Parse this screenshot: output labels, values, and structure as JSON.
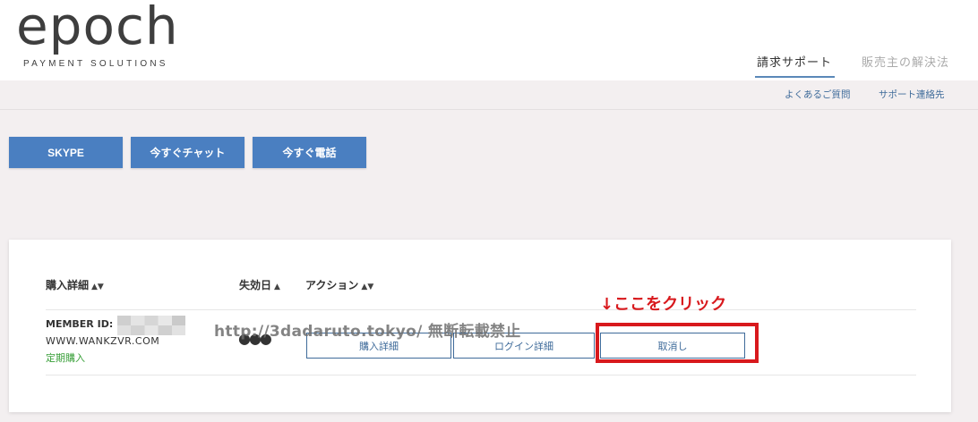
{
  "brand": {
    "logo": "epoch",
    "tagline": "PAYMENT SOLUTIONS"
  },
  "nav": {
    "tabs": [
      {
        "label": "請求サポート",
        "active": true
      },
      {
        "label": "販売主の解決法",
        "active": false
      }
    ],
    "links": {
      "faq": "よくあるご質問",
      "contact": "サポート連絡先"
    }
  },
  "contact_buttons": {
    "skype": "SKYPE",
    "chat": "今すぐチャット",
    "phone": "今すぐ電話"
  },
  "table": {
    "headers": {
      "purchase_details": "購入詳細",
      "expiry": "失効日",
      "action": "アクション"
    },
    "rows": [
      {
        "member_label": "MEMBER ID:",
        "site": "WWW.WANKZVR.COM",
        "plan": "定期購入",
        "expiry": "●●●",
        "actions": {
          "details": "購入詳細",
          "login": "ログイン詳細",
          "cancel": "取消し"
        }
      }
    ]
  },
  "overlay": {
    "watermark": "http://3dadaruto.tokyo/  無断転載禁止",
    "annotation": "↓ここをクリック"
  },
  "colors": {
    "primary_blue": "#4a7fc1",
    "link_blue": "#3f6b9a",
    "highlight_red": "#d8191d",
    "plan_green": "#3aa03a"
  }
}
